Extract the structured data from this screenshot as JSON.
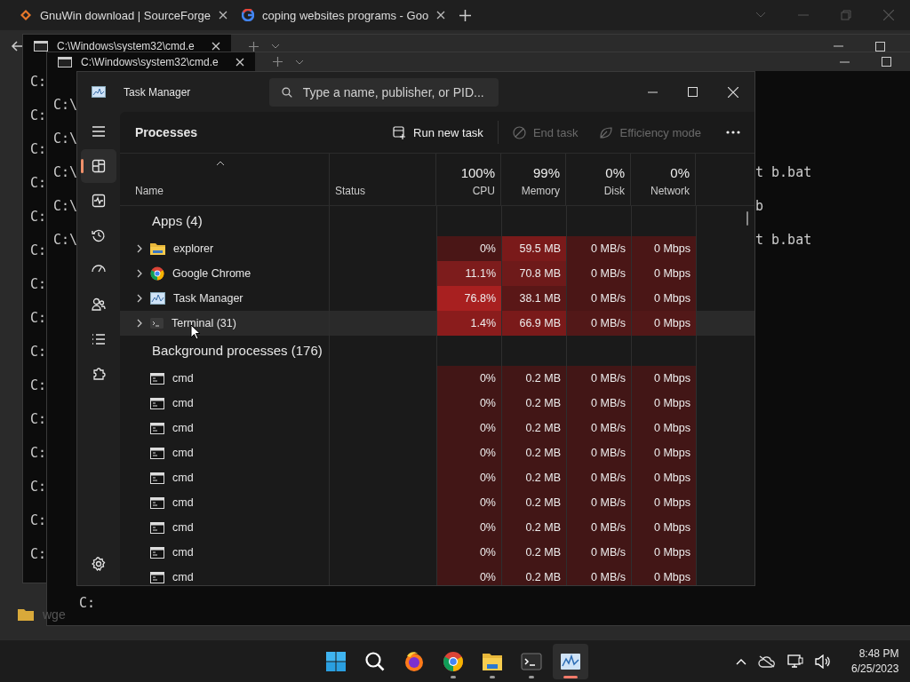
{
  "browser": {
    "tabs": [
      {
        "title": "GnuWin download | SourceForge"
      },
      {
        "title": "coping websites programs - Goo"
      }
    ]
  },
  "back_console": {
    "tab_title": "C:\\Windows\\system32\\cmd.e",
    "lines": [
      "C:",
      "C:",
      "C:",
      "C:",
      "C:",
      "C:",
      "C:",
      "C:",
      "C:",
      "C:",
      "C:",
      "C:",
      "C:",
      "C:",
      "C:"
    ]
  },
  "front_console": {
    "tab_title": "C:\\Windows\\system32\\cmd.e",
    "lines": [
      {
        "start": "C:\\"
      },
      {
        "start": "C:\\"
      },
      {
        "start": "C:\\",
        "end": "t b.bat"
      },
      {
        "start": "C:\\",
        "end": "b"
      },
      {
        "start": "C:\\",
        "end": "t b.bat"
      }
    ],
    "bottom_line": "C:"
  },
  "desktop_item": {
    "label": "wge"
  },
  "task_manager": {
    "title": "Task Manager",
    "search": {
      "placeholder": "Type a name, publisher, or PID..."
    },
    "nav": [
      {
        "kind": "menu",
        "selected": false
      },
      {
        "kind": "processes",
        "selected": true
      },
      {
        "kind": "performance",
        "selected": false
      },
      {
        "kind": "history",
        "selected": false
      },
      {
        "kind": "startup",
        "selected": false
      },
      {
        "kind": "users",
        "selected": false
      },
      {
        "kind": "details",
        "selected": false
      },
      {
        "kind": "services",
        "selected": false
      },
      {
        "kind": "settings",
        "selected": false
      }
    ],
    "page_title": "Processes",
    "actions": [
      {
        "kind": "run",
        "label": "Run new task",
        "disabled": false
      },
      {
        "kind": "end",
        "label": "End task",
        "disabled": true
      },
      {
        "kind": "efficiency",
        "label": "Efficiency mode",
        "disabled": true
      }
    ],
    "columns": [
      {
        "label": "Name",
        "sorted": true
      },
      {
        "label": "Status"
      },
      {
        "label": "CPU",
        "total": "100%"
      },
      {
        "label": "Memory",
        "total": "99%"
      },
      {
        "label": "Disk",
        "total": "0%"
      },
      {
        "label": "Network",
        "total": "0%"
      }
    ],
    "groups": [
      {
        "title": "Apps (4)",
        "rows": [
          {
            "name": "explorer",
            "kind": "folder",
            "expandable": true,
            "selected": false,
            "cells": [
              {
                "value": "0%",
                "color": "#4a1616"
              },
              {
                "value": "59.5 MB",
                "color": "#7a1a1a"
              },
              {
                "value": "0 MB/s",
                "color": "#4a1616"
              },
              {
                "value": "0 Mbps",
                "color": "#4a1616"
              }
            ]
          },
          {
            "name": "Google Chrome",
            "kind": "chrome",
            "expandable": true,
            "selected": false,
            "cells": [
              {
                "value": "11.1%",
                "color": "#7d1c1c"
              },
              {
                "value": "70.8 MB",
                "color": "#6e1a1a"
              },
              {
                "value": "0 MB/s",
                "color": "#4a1616"
              },
              {
                "value": "0 Mbps",
                "color": "#4a1616"
              }
            ]
          },
          {
            "name": "Task Manager",
            "kind": "taskmgr",
            "expandable": true,
            "selected": false,
            "cells": [
              {
                "value": "76.8%",
                "color": "#a82020"
              },
              {
                "value": "38.1 MB",
                "color": "#5a1717"
              },
              {
                "value": "0 MB/s",
                "color": "#4a1616"
              },
              {
                "value": "0 Mbps",
                "color": "#4a1616"
              }
            ]
          },
          {
            "name": "Terminal (31)",
            "kind": "terminal",
            "expandable": true,
            "selected": true,
            "cells": [
              {
                "value": "1.4%",
                "color": "#8a1c1c"
              },
              {
                "value": "66.9 MB",
                "color": "#7a1a1a"
              },
              {
                "value": "0 MB/s",
                "color": "#521818"
              },
              {
                "value": "0 Mbps",
                "color": "#521818"
              }
            ]
          }
        ]
      },
      {
        "title": "Background processes (176)",
        "rows": [
          {
            "name": "cmd",
            "kind": "console",
            "expandable": false,
            "selected": false,
            "cells": [
              {
                "value": "0%",
                "color": "#421616"
              },
              {
                "value": "0.2 MB",
                "color": "#421616"
              },
              {
                "value": "0 MB/s",
                "color": "#421616"
              },
              {
                "value": "0 Mbps",
                "color": "#421616"
              }
            ]
          },
          {
            "name": "cmd",
            "kind": "console",
            "expandable": false,
            "selected": false,
            "cells": [
              {
                "value": "0%",
                "color": "#421616"
              },
              {
                "value": "0.2 MB",
                "color": "#421616"
              },
              {
                "value": "0 MB/s",
                "color": "#421616"
              },
              {
                "value": "0 Mbps",
                "color": "#421616"
              }
            ]
          },
          {
            "name": "cmd",
            "kind": "console",
            "expandable": false,
            "selected": false,
            "cells": [
              {
                "value": "0%",
                "color": "#421616"
              },
              {
                "value": "0.2 MB",
                "color": "#421616"
              },
              {
                "value": "0 MB/s",
                "color": "#421616"
              },
              {
                "value": "0 Mbps",
                "color": "#421616"
              }
            ]
          },
          {
            "name": "cmd",
            "kind": "console",
            "expandable": false,
            "selected": false,
            "cells": [
              {
                "value": "0%",
                "color": "#421616"
              },
              {
                "value": "0.2 MB",
                "color": "#421616"
              },
              {
                "value": "0 MB/s",
                "color": "#421616"
              },
              {
                "value": "0 Mbps",
                "color": "#421616"
              }
            ]
          },
          {
            "name": "cmd",
            "kind": "console",
            "expandable": false,
            "selected": false,
            "cells": [
              {
                "value": "0%",
                "color": "#421616"
              },
              {
                "value": "0.2 MB",
                "color": "#421616"
              },
              {
                "value": "0 MB/s",
                "color": "#421616"
              },
              {
                "value": "0 Mbps",
                "color": "#421616"
              }
            ]
          },
          {
            "name": "cmd",
            "kind": "console",
            "expandable": false,
            "selected": false,
            "cells": [
              {
                "value": "0%",
                "color": "#421616"
              },
              {
                "value": "0.2 MB",
                "color": "#421616"
              },
              {
                "value": "0 MB/s",
                "color": "#421616"
              },
              {
                "value": "0 Mbps",
                "color": "#421616"
              }
            ]
          },
          {
            "name": "cmd",
            "kind": "console",
            "expandable": false,
            "selected": false,
            "cells": [
              {
                "value": "0%",
                "color": "#421616"
              },
              {
                "value": "0.2 MB",
                "color": "#421616"
              },
              {
                "value": "0 MB/s",
                "color": "#421616"
              },
              {
                "value": "0 Mbps",
                "color": "#421616"
              }
            ]
          },
          {
            "name": "cmd",
            "kind": "console",
            "expandable": false,
            "selected": false,
            "cells": [
              {
                "value": "0%",
                "color": "#421616"
              },
              {
                "value": "0.2 MB",
                "color": "#421616"
              },
              {
                "value": "0 MB/s",
                "color": "#421616"
              },
              {
                "value": "0 Mbps",
                "color": "#421616"
              }
            ]
          },
          {
            "name": "cmd",
            "kind": "console",
            "expandable": false,
            "selected": false,
            "cells": [
              {
                "value": "0%",
                "color": "#421616"
              },
              {
                "value": "0.2 MB",
                "color": "#421616"
              },
              {
                "value": "0 MB/s",
                "color": "#421616"
              },
              {
                "value": "0 Mbps",
                "color": "#421616"
              }
            ]
          }
        ]
      }
    ]
  },
  "taskbar": {
    "apps": [
      {
        "kind": "start",
        "running": false,
        "selected": false
      },
      {
        "kind": "search",
        "running": false,
        "selected": false
      },
      {
        "kind": "firefox",
        "running": false,
        "selected": false
      },
      {
        "kind": "chrome",
        "running": true,
        "selected": false
      },
      {
        "kind": "files",
        "running": true,
        "selected": false
      },
      {
        "kind": "terminal",
        "running": true,
        "selected": false
      },
      {
        "kind": "taskmgr",
        "running": true,
        "selected": true
      }
    ],
    "time": "8:48 PM",
    "date": "6/25/2023"
  }
}
